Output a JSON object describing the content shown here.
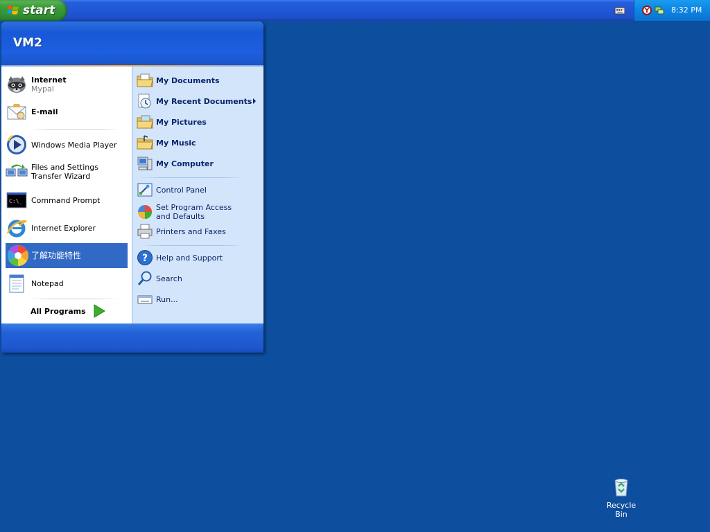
{
  "taskbar": {
    "start_label": "start",
    "clock": "8:32 PM",
    "tray_icons": [
      "keyboard-icon",
      "antivirus-icon",
      "network-icon"
    ]
  },
  "start_menu": {
    "user_name": "VM2",
    "pinned": [
      {
        "label": "Internet",
        "sub": "Mypal",
        "icon": "raccoon-browser-icon"
      },
      {
        "label": "E-mail",
        "icon": "email-icon"
      }
    ],
    "recent": [
      {
        "label": "Windows Media Player",
        "icon": "media-player-icon"
      },
      {
        "label": "Files and Settings Transfer Wizard",
        "icon": "transfer-wizard-icon"
      },
      {
        "label": "Command Prompt",
        "icon": "command-prompt-icon"
      },
      {
        "label": "Internet Explorer",
        "icon": "internet-explorer-icon"
      },
      {
        "label": "了解功能特性",
        "icon": "features-tour-icon",
        "highlighted": true
      },
      {
        "label": "Notepad",
        "icon": "notepad-icon"
      }
    ],
    "all_programs": "All Programs",
    "right_places": [
      {
        "label": "My Documents",
        "icon": "my-documents-icon"
      },
      {
        "label": "My Recent Documents",
        "icon": "recent-documents-icon",
        "submenu": true
      },
      {
        "label": "My Pictures",
        "icon": "my-pictures-icon"
      },
      {
        "label": "My Music",
        "icon": "my-music-icon"
      },
      {
        "label": "My Computer",
        "icon": "my-computer-icon"
      }
    ],
    "right_settings": [
      {
        "label": "Control Panel",
        "icon": "control-panel-icon"
      },
      {
        "label": "Set Program Access and Defaults",
        "icon": "program-access-icon"
      },
      {
        "label": "Printers and Faxes",
        "icon": "printers-icon"
      }
    ],
    "right_help": [
      {
        "label": "Help and Support",
        "icon": "help-icon"
      },
      {
        "label": "Search",
        "icon": "search-icon"
      },
      {
        "label": "Run...",
        "icon": "run-icon"
      }
    ]
  },
  "desktop": {
    "recycle_bin": "Recycle Bin"
  },
  "colors": {
    "desktop": "#0d4e9e",
    "taskbar": "#245edb",
    "start_button": "#3e9e3a",
    "highlight": "#316ac5"
  }
}
